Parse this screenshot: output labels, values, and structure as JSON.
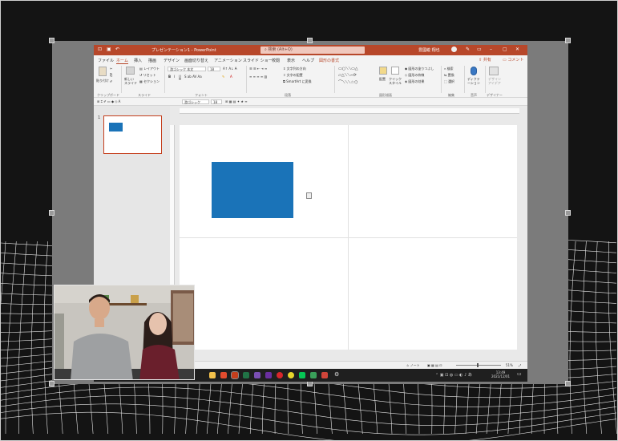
{
  "powerpoint": {
    "window_title": "プレゼンテーション1 - PowerPoint",
    "search_placeholder": "検索 (Alt+Q)",
    "user_name": "豊國峻 翔也",
    "tabs": [
      "ファイル",
      "ホーム",
      "挿入",
      "描画",
      "デザイン",
      "画面切り替え",
      "アニメーション",
      "スライド ショー",
      "校閲",
      "表示",
      "ヘルプ",
      "図形の書式"
    ],
    "active_tab": "ホーム",
    "share_label": "共有",
    "comment_label": "コメント",
    "ribbon": {
      "groups": [
        "クリップボード",
        "スライド",
        "フォント",
        "段落",
        "図形描画",
        "編集",
        "音声",
        "デザイナー"
      ],
      "paste_label": "貼り付け",
      "new_slide_label": "新しい スライド",
      "layout_label": "レイアウト",
      "reset_label": "リセット",
      "section_label": "セクション",
      "font_name": "游ゴシック 本文",
      "font_size": "18",
      "text_direction_label": "文字列の方向",
      "align_text_label": "文字の配置",
      "smartart_label": "SmartArt に変換",
      "arrange_label": "配置",
      "quick_styles_label": "クイック スタイル",
      "shape_fill_label": "図形の塗りつぶし",
      "shape_outline_label": "図形の枠線",
      "shape_effects_label": "図形の効果",
      "find_label": "検索",
      "replace_label": "置換",
      "select_label": "選択",
      "dictate_label": "ディクテーション",
      "designer_label": "デザイン アイデア"
    },
    "qat": {
      "font_name": "游ゴシック",
      "font_size": "18"
    },
    "slide_number": "1",
    "status": {
      "notes_label": "ノート",
      "zoom": "51%"
    },
    "clock": {
      "time": "13:49",
      "date": "2021/12/01"
    }
  },
  "colors": {
    "accent": "#b7472a",
    "shape_fill": "#1a73b8"
  }
}
